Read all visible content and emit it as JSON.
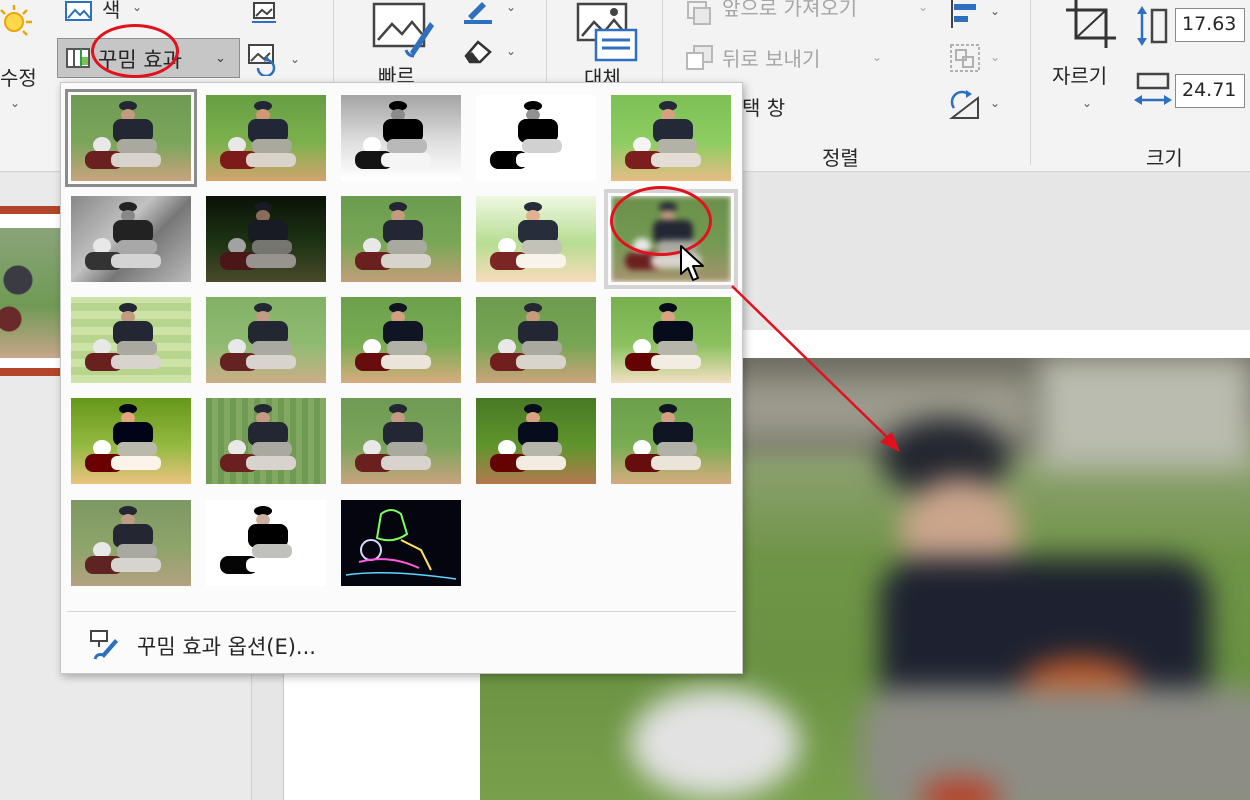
{
  "ribbon": {
    "adjust": {
      "corrections_label": "수정",
      "color_label": "색",
      "artistic_effects_label": "꾸밈 효과"
    },
    "remove_background_label": "빠르",
    "alt_text_label": "대체",
    "arrange": {
      "bring_forward_label": "앞으로 가져오기",
      "send_backward_label": "뒤로 보내기",
      "selection_pane_label": "택 창",
      "group_label": "정렬"
    },
    "size": {
      "crop_label": "자르기",
      "height_value": "17.63",
      "width_value": "24.71",
      "group_label": "크기"
    }
  },
  "gallery": {
    "options_label": "꾸밈 효과 옵션(E)...",
    "effects": [
      {
        "id": "none",
        "state": "selected"
      },
      {
        "id": "marker"
      },
      {
        "id": "pencil-grayscale"
      },
      {
        "id": "pencil-sketch"
      },
      {
        "id": "line-drawing"
      },
      {
        "id": "chalk-sketch"
      },
      {
        "id": "paint-strokes"
      },
      {
        "id": "paint-brush"
      },
      {
        "id": "glow-diffused"
      },
      {
        "id": "blur",
        "state": "hovered"
      },
      {
        "id": "light-screen"
      },
      {
        "id": "watercolor-sponge"
      },
      {
        "id": "film-grain"
      },
      {
        "id": "mosaic-bubbles"
      },
      {
        "id": "glass"
      },
      {
        "id": "cement"
      },
      {
        "id": "texturizer"
      },
      {
        "id": "crisscross-etching"
      },
      {
        "id": "pastels-smooth"
      },
      {
        "id": "plastic-wrap"
      },
      {
        "id": "cutout"
      },
      {
        "id": "photocopy"
      },
      {
        "id": "glow-edges"
      }
    ]
  },
  "colors": {
    "annotation_red": "#e1121d",
    "slide_accent": "#b3462a",
    "ribbon_bg": "#f3f3f3"
  }
}
